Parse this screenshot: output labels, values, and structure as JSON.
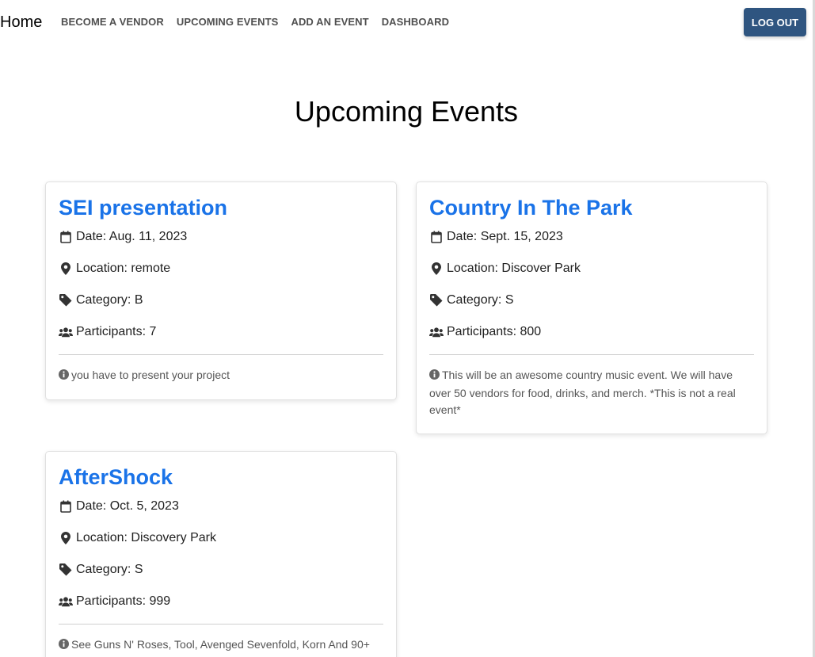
{
  "nav": {
    "brand": "Home",
    "links": [
      "BECOME A VENDOR",
      "UPCOMING EVENTS",
      "ADD AN EVENT",
      "DASHBOARD"
    ],
    "logout_label": "LOG OUT"
  },
  "page": {
    "title": "Upcoming Events"
  },
  "events": [
    {
      "title": "SEI presentation",
      "date": "Date: Aug. 11, 2023",
      "location": "Location: remote",
      "category": "Category: B",
      "participants": "Participants: 7",
      "description": "you have to present your project"
    },
    {
      "title": "Country In The Park",
      "date": "Date: Sept. 15, 2023",
      "location": "Location: Discover Park",
      "category": "Category: S",
      "participants": "Participants: 800",
      "description": "This will be an awesome country music event. We will have over 50 vendors for food, drinks, and merch. *This is not a real event*"
    },
    {
      "title": "AfterShock",
      "date": "Date: Oct. 5, 2023",
      "location": "Location: Discovery Park",
      "category": "Category: S",
      "participants": "Participants: 999",
      "description": "See Guns N' Roses, Tool, Avenged Sevenfold, Korn And 90+"
    }
  ],
  "icons": {
    "date": "calendar-icon",
    "location": "map-marker-icon",
    "category": "tag-icon",
    "participants": "users-icon",
    "description": "info-circle-icon"
  },
  "colors": {
    "accent": "#1a73e8",
    "logout_button": "#2f5580"
  }
}
